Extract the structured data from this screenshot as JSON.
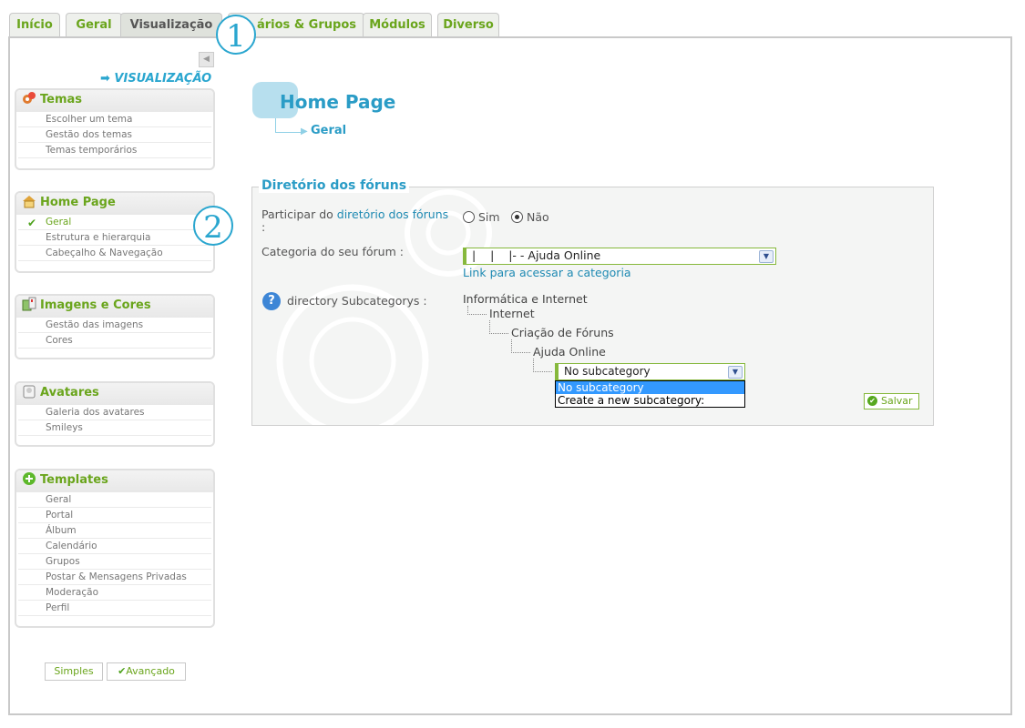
{
  "tabs": [
    "Início",
    "Geral",
    "Visualização",
    "ários & Grupos",
    "Módulos",
    "Diverso"
  ],
  "callouts": {
    "one": "1",
    "two": "2"
  },
  "sidebar": {
    "section_title": "VISUALIZAÇÃO",
    "panels": [
      {
        "title": "Temas",
        "icon": "palette-icon",
        "items": [
          "Escolher um tema",
          "Gestão dos temas",
          "Temas temporários"
        ]
      },
      {
        "title": "Home Page",
        "icon": "house-icon",
        "items": [
          "Geral",
          "Estrutura e hierarquia",
          "Cabeçalho & Navegação"
        ],
        "active_item": "Geral"
      },
      {
        "title": "Imagens e Cores",
        "icon": "images-icon",
        "items": [
          "Gestão das imagens",
          "Cores"
        ]
      },
      {
        "title": "Avatares",
        "icon": "avatar-icon",
        "items": [
          "Galeria dos avatares",
          "Smileys"
        ]
      },
      {
        "title": "Templates",
        "icon": "plus-circle-icon",
        "items": [
          "Geral",
          "Portal",
          "Álbum",
          "Calendário",
          "Grupos",
          "Postar & Mensagens Privadas",
          "Moderação",
          "Perfil"
        ]
      }
    ],
    "mode_buttons": {
      "simple": "Simples",
      "advanced": "Avançado"
    }
  },
  "header": {
    "title": "Home Page",
    "subtitle": "Geral"
  },
  "fieldset": {
    "legend": "Diretório dos fóruns",
    "participate": {
      "label_prefix": "Participar do ",
      "label_link": "diretório dos fóruns",
      "label_suffix": ":",
      "options": [
        "Sim",
        "Não"
      ],
      "selected": "Não"
    },
    "category": {
      "label": "Categoria do seu fórum :",
      "value": "|    |    |- - Ajuda Online",
      "link": "Link para acessar a categoria"
    },
    "subcategory": {
      "label": "directory Subcategorys :",
      "tree": [
        "Informática e Internet",
        "Internet",
        "Criação de Fóruns",
        "Ajuda Online"
      ],
      "select_value": "No subcategory",
      "dropdown_options": [
        "No subcategory",
        "Create a new subcategory:"
      ],
      "highlighted": "No subcategory"
    },
    "save": "Salvar"
  },
  "colors": {
    "accent_green": "#6aa51c",
    "accent_blue": "#2a9cc6",
    "callout_blue": "#2aa6cf"
  }
}
